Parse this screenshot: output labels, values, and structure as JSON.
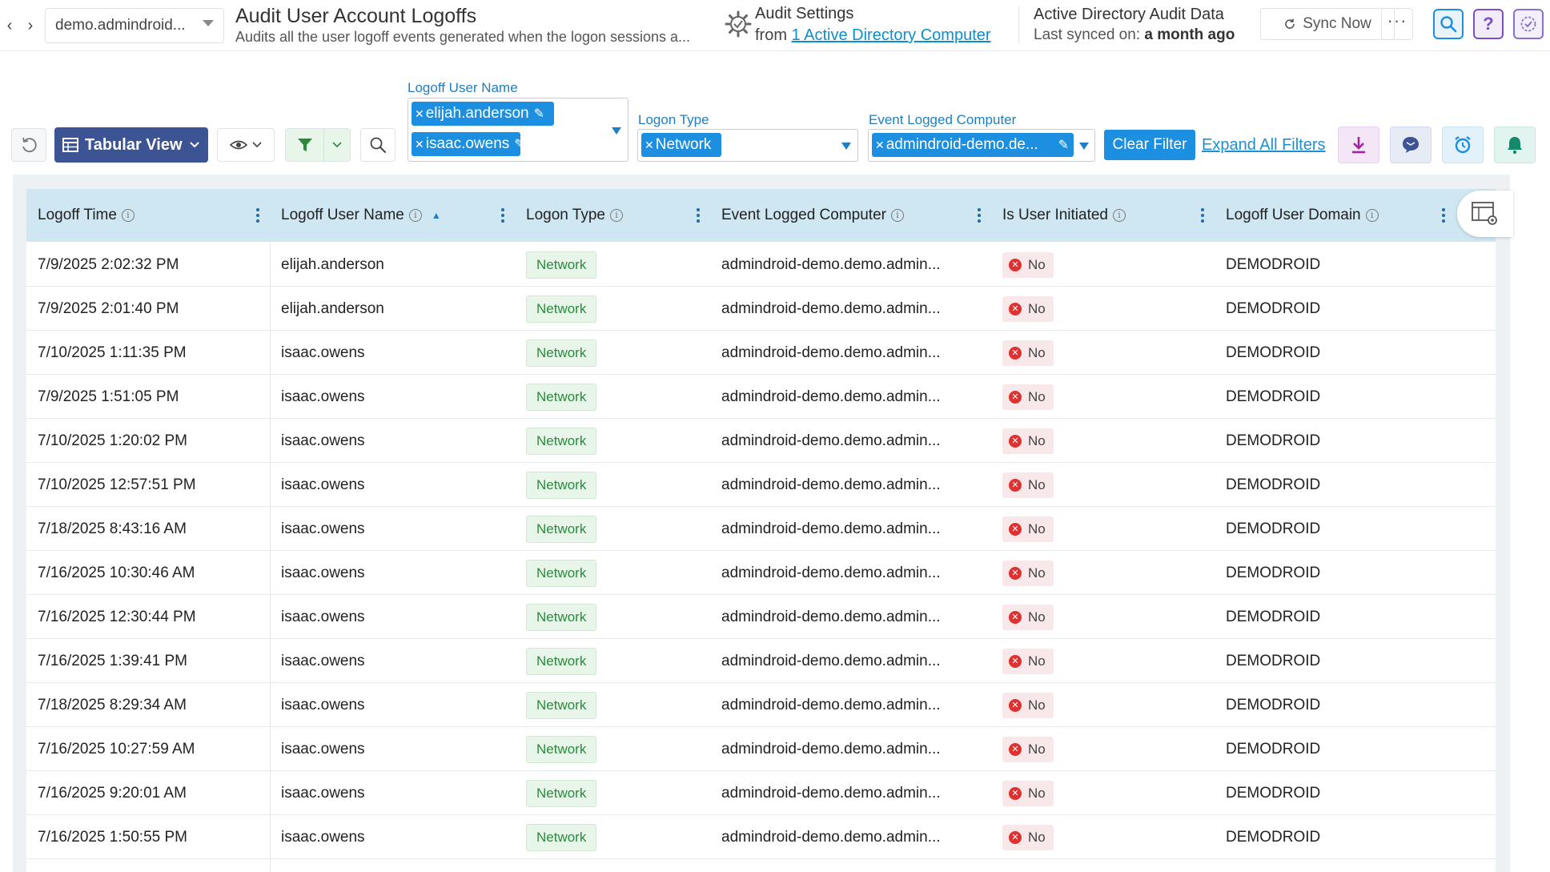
{
  "header": {
    "tenant": "demo.admindroid...",
    "title": "Audit User Account Logoffs",
    "subtitle": "Audits all the user logoff events generated when the logon sessions a...",
    "audit_settings_title": "Audit Settings",
    "audit_settings_from": "from",
    "audit_settings_link": "1 Active Directory Computer",
    "ad_title": "Active Directory Audit Data",
    "ad_sync_label": "Last synced on:",
    "ad_sync_value": "a month ago",
    "sync_now": "Sync Now",
    "more": "···",
    "help": "?"
  },
  "toolbar": {
    "view_label": "Tabular View"
  },
  "filters": {
    "user_name": {
      "label": "Logoff User Name",
      "chips": [
        "elijah.anderson",
        "isaac.owens"
      ]
    },
    "logon_type": {
      "label": "Logon Type",
      "chips": [
        "Network"
      ]
    },
    "computer": {
      "label": "Event Logged Computer",
      "chips": [
        "admindroid-demo.de..."
      ]
    },
    "clear": "Clear Filter",
    "expand": "Expand All Filters"
  },
  "table": {
    "columns": [
      "Logoff Time",
      "Logoff User Name",
      "Logon Type",
      "Event Logged Computer",
      "Is User Initiated",
      "Logoff User Domain"
    ],
    "rows": [
      [
        "7/9/2025 2:02:32 PM",
        "elijah.anderson",
        "Network",
        "admindroid-demo.demo.admin...",
        "No",
        "DEMODROID"
      ],
      [
        "7/9/2025 2:01:40 PM",
        "elijah.anderson",
        "Network",
        "admindroid-demo.demo.admin...",
        "No",
        "DEMODROID"
      ],
      [
        "7/10/2025 1:11:35 PM",
        "isaac.owens",
        "Network",
        "admindroid-demo.demo.admin...",
        "No",
        "DEMODROID"
      ],
      [
        "7/9/2025 1:51:05 PM",
        "isaac.owens",
        "Network",
        "admindroid-demo.demo.admin...",
        "No",
        "DEMODROID"
      ],
      [
        "7/10/2025 1:20:02 PM",
        "isaac.owens",
        "Network",
        "admindroid-demo.demo.admin...",
        "No",
        "DEMODROID"
      ],
      [
        "7/10/2025 12:57:51 PM",
        "isaac.owens",
        "Network",
        "admindroid-demo.demo.admin...",
        "No",
        "DEMODROID"
      ],
      [
        "7/18/2025 8:43:16 AM",
        "isaac.owens",
        "Network",
        "admindroid-demo.demo.admin...",
        "No",
        "DEMODROID"
      ],
      [
        "7/16/2025 10:30:46 AM",
        "isaac.owens",
        "Network",
        "admindroid-demo.demo.admin...",
        "No",
        "DEMODROID"
      ],
      [
        "7/16/2025 12:30:44 PM",
        "isaac.owens",
        "Network",
        "admindroid-demo.demo.admin...",
        "No",
        "DEMODROID"
      ],
      [
        "7/16/2025 1:39:41 PM",
        "isaac.owens",
        "Network",
        "admindroid-demo.demo.admin...",
        "No",
        "DEMODROID"
      ],
      [
        "7/18/2025 8:29:34 AM",
        "isaac.owens",
        "Network",
        "admindroid-demo.demo.admin...",
        "No",
        "DEMODROID"
      ],
      [
        "7/16/2025 10:27:59 AM",
        "isaac.owens",
        "Network",
        "admindroid-demo.demo.admin...",
        "No",
        "DEMODROID"
      ],
      [
        "7/16/2025 9:20:01 AM",
        "isaac.owens",
        "Network",
        "admindroid-demo.demo.admin...",
        "No",
        "DEMODROID"
      ],
      [
        "7/16/2025 1:50:55 PM",
        "isaac.owens",
        "Network",
        "admindroid-demo.demo.admin...",
        "No",
        "DEMODROID"
      ]
    ]
  },
  "colors": {
    "primary": "#1d8fe1",
    "view_button": "#3c5493",
    "header_row": "#cfe7f2",
    "network_badge": "#2b8a3e",
    "no_badge_icon": "#e03131"
  }
}
